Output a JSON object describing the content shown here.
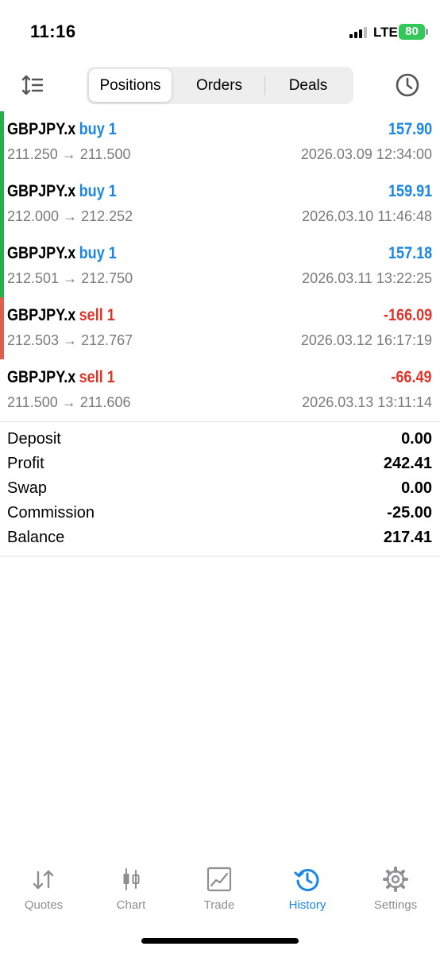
{
  "status_bar": {
    "time": "11:16",
    "network": "LTE",
    "battery": "80"
  },
  "toolbar": {
    "tabs": [
      {
        "label": "Positions",
        "active": true
      },
      {
        "label": "Orders",
        "active": false
      },
      {
        "label": "Deals",
        "active": false
      }
    ]
  },
  "trades": [
    {
      "symbol": "GBPJPY.x",
      "direction": "buy 1",
      "type": "buy",
      "profit": "157.90",
      "prices": "211.250 → 211.500",
      "time": "2026.03.09 12:34:00"
    },
    {
      "symbol": "GBPJPY.x",
      "direction": "buy 1",
      "type": "buy",
      "profit": "159.91",
      "prices": "212.000 → 212.252",
      "time": "2026.03.10 11:46:48"
    },
    {
      "symbol": "GBPJPY.x",
      "direction": "buy 1",
      "type": "buy",
      "profit": "157.18",
      "prices": "212.501 → 212.750",
      "time": "2026.03.11 13:22:25"
    },
    {
      "symbol": "GBPJPY.x",
      "direction": "sell 1",
      "type": "sell",
      "profit": "-166.09",
      "prices": "212.503 → 212.767",
      "time": "2026.03.12 16:17:19"
    },
    {
      "symbol": "GBPJPY.x",
      "direction": "sell 1",
      "type": "sell",
      "profit": "-66.49",
      "prices": "211.500 → 211.606",
      "time": "2026.03.13 13:11:14"
    }
  ],
  "summary": [
    {
      "label": "Deposit",
      "value": "0.00"
    },
    {
      "label": "Profit",
      "value": "242.41"
    },
    {
      "label": "Swap",
      "value": "0.00"
    },
    {
      "label": "Commission",
      "value": "-25.00"
    },
    {
      "label": "Balance",
      "value": "217.41"
    }
  ],
  "tabbar": [
    {
      "label": "Quotes",
      "icon": "quotes-icon",
      "active": false
    },
    {
      "label": "Chart",
      "icon": "chart-icon",
      "active": false
    },
    {
      "label": "Trade",
      "icon": "trade-icon",
      "active": false
    },
    {
      "label": "History",
      "icon": "history-icon",
      "active": true
    },
    {
      "label": "Settings",
      "icon": "settings-icon",
      "active": false
    }
  ],
  "colors": {
    "buy": "#1a86e8",
    "sell": "#e0352b",
    "buy_bar": "#23b14d",
    "sell_bar": "#e35d4f",
    "active_tab": "#1a86e8",
    "inactive_tab": "#8e8e93"
  }
}
